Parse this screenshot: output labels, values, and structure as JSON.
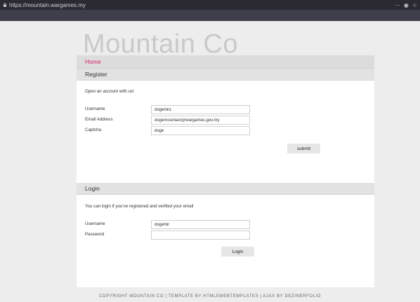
{
  "browser": {
    "url": "https://mountain.wargames.my",
    "icons": [
      "lock-icon",
      "more-icon",
      "pocket-icon",
      "bookmark-star-icon"
    ],
    "more_glyph": "···",
    "pocket_glyph": "◉",
    "star_glyph": "☆"
  },
  "site": {
    "logo": "Mountain Co",
    "nav": {
      "home": "Home"
    }
  },
  "register": {
    "title": "Register",
    "intro": "Open an account with us!",
    "username_label": "Username",
    "username_value": "dogehill1",
    "email_label": "Email Address",
    "email_value": "dogemountain@wargames.gov.my",
    "captcha_label": "Captcha",
    "captcha_value": "doge",
    "submit_label": "submit"
  },
  "login": {
    "title": "Login",
    "intro": "You can login if you've registered and verified your email",
    "username_label": "Username",
    "username_value": "dogehill",
    "password_label": "Password",
    "password_value": "",
    "login_label": "Login"
  },
  "footer": {
    "text": "COPYRIGHT MOUNTAIN CO | TEMPLATE BY HTML5WEBTEMPLATES | AJAX BY DEZINERFOLIO"
  },
  "colors": {
    "accent": "#d6236b",
    "section_bg": "#e2e2e2",
    "page_bg": "#ededed"
  }
}
